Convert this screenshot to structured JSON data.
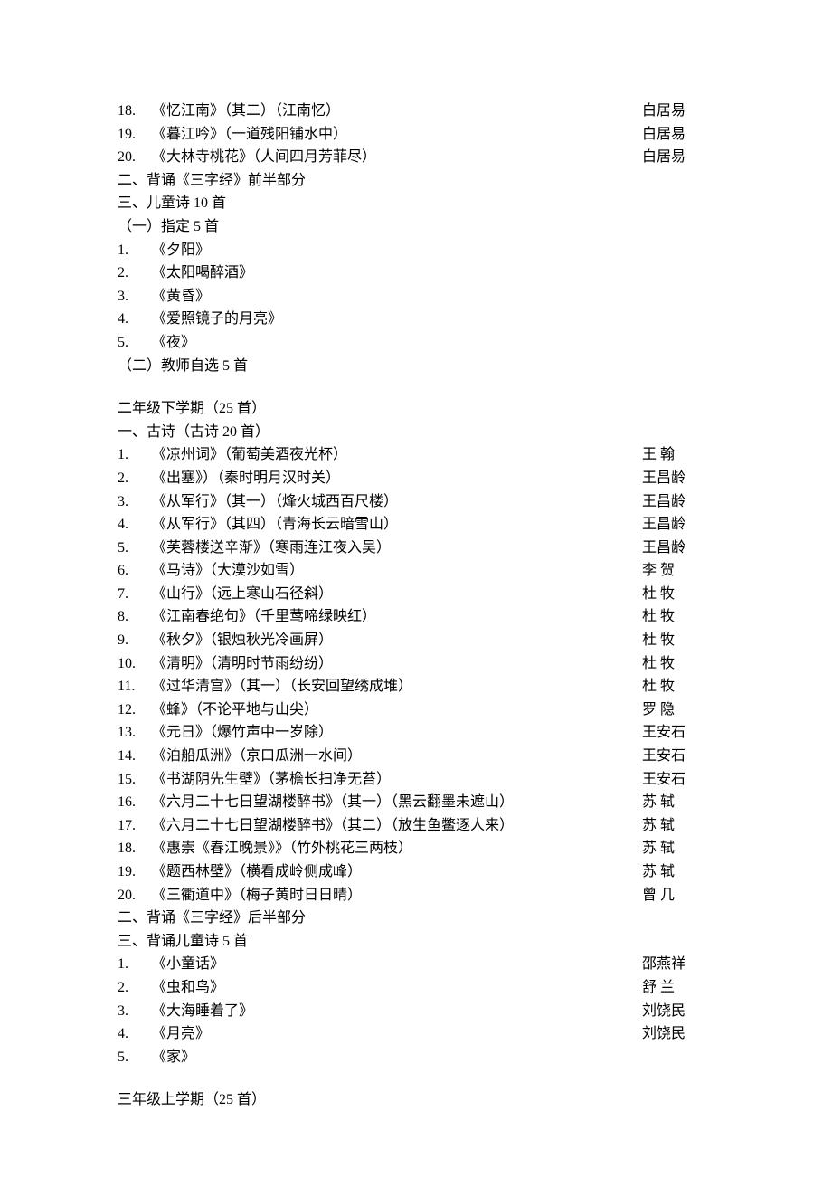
{
  "top_poems": [
    {
      "num": "18.",
      "title": "《忆江南》（其二）（江南忆）",
      "author": "白居易"
    },
    {
      "num": "19.",
      "title": "《暮江吟》（一道残阳铺水中）",
      "author": "白居易"
    },
    {
      "num": "20.",
      "title": "《大林寺桃花》（人间四月芳菲尽）",
      "author": "白居易"
    }
  ],
  "headings_top": [
    "二、背诵《三字经》前半部分",
    "三、儿童诗 10 首",
    "（一）指定 5 首"
  ],
  "child_poems_a": [
    {
      "num": "1.",
      "title": "《夕阳》"
    },
    {
      "num": "2.",
      "title": "《太阳喝醉酒》"
    },
    {
      "num": "3.",
      "title": "《黄昏》"
    },
    {
      "num": "4.",
      "title": "《爱照镜子的月亮》"
    },
    {
      "num": "5.",
      "title": "《夜》"
    }
  ],
  "headings_mid1": [
    "（二）教师自选 5 首"
  ],
  "section2_title": "二年级下学期（25 首）",
  "section2_sub": "一、古诗（古诗 20 首）",
  "section2_poems": [
    {
      "num": "1.",
      "title": "《凉州词》（葡萄美酒夜光杯）",
      "author": "王  翰"
    },
    {
      "num": "2.",
      "title": "《出塞》）（秦时明月汉时关）",
      "author": "王昌龄"
    },
    {
      "num": "3.",
      "title": "《从军行》（其一）（烽火城西百尺楼）",
      "author": "王昌龄"
    },
    {
      "num": "4.",
      "title": "《从军行》（其四）（青海长云暗雪山）",
      "author": "王昌龄"
    },
    {
      "num": "5.",
      "title": "《芙蓉楼送辛渐》（寒雨连江夜入吴）",
      "author": "王昌龄"
    },
    {
      "num": "6.",
      "title": "《马诗》（大漠沙如雪）",
      "author": "李  贺"
    },
    {
      "num": "7.",
      "title": "《山行》（远上寒山石径斜）",
      "author": "杜  牧"
    },
    {
      "num": "8.",
      "title": "《江南春绝句》（千里莺啼绿映红）",
      "author": "杜  牧"
    },
    {
      "num": "9.",
      "title": "《秋夕》（银烛秋光冷画屏）",
      "author": "杜  牧"
    },
    {
      "num": "10.",
      "title": " 《清明》（清明时节雨纷纷）",
      "author": "杜  牧"
    },
    {
      "num": "11.",
      "title": " 《过华清宫》（其一）（长安回望绣成堆）",
      "author": " 杜  牧"
    },
    {
      "num": "12.",
      "title": " 《蜂》（不论平地与山尖）",
      "author": "罗  隐"
    },
    {
      "num": "13.",
      "title": " 《元日》（爆竹声中一岁除）",
      "author": "王安石"
    },
    {
      "num": "14.",
      "title": " 《泊船瓜洲》（京口瓜洲一水间）",
      "author": "王安石"
    },
    {
      "num": "15.",
      "title": " 《书湖阴先生壁》（茅檐长扫净无苔）",
      "author": "王安石"
    },
    {
      "num": "16.",
      "title": " 《六月二十七日望湖楼醉书》（其一）（黑云翻墨未遮山）",
      "author": "苏  轼"
    },
    {
      "num": "17.",
      "title": " 《六月二十七日望湖楼醉书》（其二）（放生鱼鳖逐人来）",
      "author": "苏  轼"
    },
    {
      "num": "18.",
      "title": " 《惠崇《春江晚景》》（竹外桃花三两枝）",
      "author": " 苏  轼"
    },
    {
      "num": "19.",
      "title": " 《题西林壁》（横看成岭侧成峰）",
      "author": " 苏  轼"
    },
    {
      "num": "20.",
      "title": " 《三衢道中》（梅子黄时日日晴）",
      "author": " 曾  几"
    }
  ],
  "headings_mid2": [
    "二、背诵《三字经》后半部分",
    "三、背诵儿童诗 5 首"
  ],
  "child_poems_b": [
    {
      "num": "1.",
      "title": "《小童话》",
      "author": "邵燕祥"
    },
    {
      "num": "2.",
      "title": "《虫和鸟》",
      "author": "舒  兰"
    },
    {
      "num": "3.",
      "title": "《大海睡着了》",
      "author": "刘饶民"
    },
    {
      "num": "4.",
      "title": "《月亮》",
      "author": "刘饶民"
    },
    {
      "num": "5.",
      "title": "《家》",
      "author": ""
    }
  ],
  "section3_title": "三年级上学期（25 首）"
}
